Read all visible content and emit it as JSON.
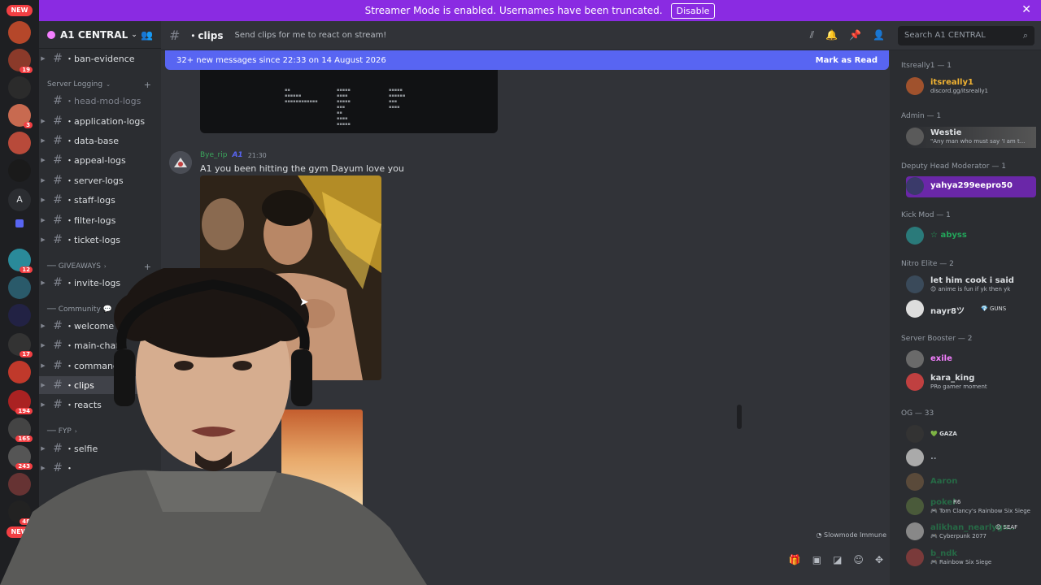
{
  "banner": {
    "text": "Streamer Mode is enabled. Usernames have been truncated.",
    "disable_label": "Disable",
    "close_icon": "close-icon"
  },
  "servers": {
    "new_badge": "NEW",
    "bottom_badge": "NEW",
    "badges": [
      "19",
      "3",
      "12",
      "17",
      "194",
      "165",
      "243",
      "48"
    ],
    "letter": "A"
  },
  "server": {
    "name": "A1 CENTRAL"
  },
  "channels": [
    {
      "label": "・ban-evidence",
      "muted": false
    },
    {
      "label": "・head-mod-logs",
      "muted": true
    },
    {
      "label": "・application-logs",
      "muted": false
    },
    {
      "label": "・data-base",
      "muted": false
    },
    {
      "label": "・appeal-logs",
      "muted": false
    },
    {
      "label": "・server-logs",
      "muted": false
    },
    {
      "label": "・staff-logs",
      "muted": false
    },
    {
      "label": "・filter-logs",
      "muted": false
    },
    {
      "label": "・ticket-logs",
      "muted": false
    },
    {
      "label": "・invite-logs",
      "muted": false
    },
    {
      "label": "・welcome",
      "muted": false
    },
    {
      "label": "・main-chat",
      "muted": false
    },
    {
      "label": "・commands",
      "muted": false
    },
    {
      "label": "・clips",
      "muted": false,
      "active": true
    },
    {
      "label": "・reacts",
      "muted": false
    },
    {
      "label": "・selfie",
      "muted": false
    },
    {
      "label": "・",
      "muted": false
    }
  ],
  "categories": [
    "Server Logging",
    "── GIVEAWAYS",
    "── Community 💬",
    "── FYP"
  ],
  "topbar": {
    "channel": "・clips",
    "topic": "Send clips for me to react on stream!",
    "search_placeholder": "Search A1 CENTRAL"
  },
  "new_messages": {
    "text": "32+ new messages since 22:33 on 14 August 2026",
    "mark_label": "Mark as Read"
  },
  "message": {
    "author": "Bye_rip",
    "tag": "A1",
    "time": "21:30",
    "text": "A1 you been hitting the gym Dayum love you"
  },
  "slowmode": "Slowmode Immune",
  "members": {
    "roles": [
      "Itsreally1 — 1",
      "Admin — 1",
      "Deputy Head Moderator — 1",
      "Kick Mod — 1",
      "Nitro Elite — 2",
      "Server Booster — 2",
      "OG — 33"
    ],
    "list": [
      {
        "name": "itsreally1",
        "status": "discord.gg/itsreally1",
        "color": "#f0b232",
        "avatar": "#a0522d"
      },
      {
        "name": "Westie",
        "status": "\"Any man who must say 'I am t...",
        "color": "#dbdee1",
        "avatar": "#5a5a5a"
      },
      {
        "name": "yahya299eepro50",
        "status": "",
        "color": "#ffffff",
        "avatar": "#3a3a6a",
        "highlight": true
      },
      {
        "name": "☆ abyss",
        "status": "",
        "color": "#23a55a",
        "avatar": "#2a7a7a"
      },
      {
        "name": "let him cook i said",
        "status": "😊 anime is fun if yk then yk",
        "color": "#dbdee1",
        "avatar": "#3a4a5a"
      },
      {
        "name": "nayr8ツ",
        "status": "",
        "color": "#dbdee1",
        "avatar": "#dddddd",
        "tag": "💎 GUNS"
      },
      {
        "name": "exile",
        "status": "",
        "color": "#f47fff",
        "avatar": "#6a6a6a"
      },
      {
        "name": "kara_king",
        "status": "PRo gamer moment",
        "color": "#dbdee1",
        "avatar": "#c04040"
      },
      {
        "name": "",
        "status": "",
        "color": "#dbdee1",
        "avatar": "#333333",
        "tag": "💚 GAZA"
      },
      {
        "name": "..",
        "status": "",
        "color": "#949ba4",
        "avatar": "#aaaaaa"
      },
      {
        "name": "Aaron",
        "status": "",
        "color": "#23a55a",
        "avatar": "#5a4a3a"
      },
      {
        "name": "pokei",
        "status": "🎮 Tom Clancy's Rainbow Six Siege",
        "color": "#23a55a",
        "avatar": "#4a5a3a",
        "tag": "R6"
      },
      {
        "name": "alikhan_nearlygr...",
        "status": "🎮 Cyberpunk 2077",
        "color": "#23a55a",
        "avatar": "#888888",
        "tag": "😊 SEAF"
      },
      {
        "name": "b_ndk",
        "status": "🎮 Rainbow Six Siege",
        "color": "#23a55a",
        "avatar": "#7a3a3a"
      }
    ]
  }
}
